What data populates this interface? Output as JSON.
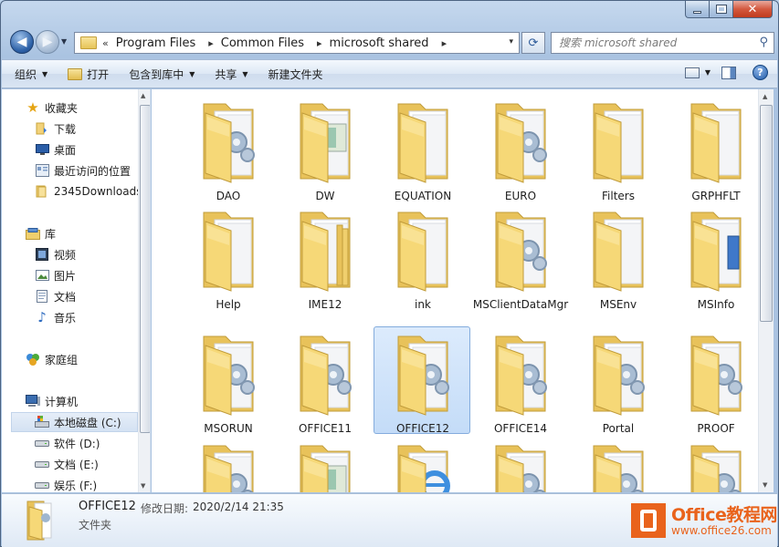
{
  "window": {
    "minimize_glyph": "",
    "close_glyph": "✕"
  },
  "address": {
    "overflow": "«",
    "crumbs": [
      "Program Files",
      "Common Files",
      "microsoft shared"
    ],
    "separator": "▸",
    "dropdown": "▾"
  },
  "search": {
    "placeholder": "搜索 microsoft shared"
  },
  "toolbar": {
    "organize": "组织",
    "open": "打开",
    "include_in_library": "包含到库中",
    "share": "共享",
    "new_folder": "新建文件夹",
    "help": "?"
  },
  "navpane": {
    "favorites": "收藏夹",
    "downloads": "下载",
    "desktop": "桌面",
    "recent": "最近访问的位置",
    "downloads2345": "2345Downloads",
    "libraries": "库",
    "videos": "视频",
    "pictures": "图片",
    "documents": "文档",
    "music": "音乐",
    "homegroup": "家庭组",
    "computer": "计算机",
    "drive_c": "本地磁盘 (C:)",
    "drive_d": "软件 (D:)",
    "drive_e": "文档 (E:)",
    "drive_f": "娱乐 (F:)"
  },
  "folders": [
    {
      "name": "DAO",
      "variant": "gear"
    },
    {
      "name": "DW",
      "variant": "doc"
    },
    {
      "name": "EQUATION",
      "variant": "plain"
    },
    {
      "name": "EURO",
      "variant": "gear"
    },
    {
      "name": "Filters",
      "variant": "plain"
    },
    {
      "name": "GRPHFLT",
      "variant": "plain"
    },
    {
      "name": "Help",
      "variant": "plain"
    },
    {
      "name": "IME12",
      "variant": "stack"
    },
    {
      "name": "ink",
      "variant": "plain"
    },
    {
      "name": "MSClientDataMgr",
      "variant": "gear"
    },
    {
      "name": "MSEnv",
      "variant": "plain"
    },
    {
      "name": "MSInfo",
      "variant": "blue"
    },
    {
      "name": "MSORUN",
      "variant": "gear"
    },
    {
      "name": "OFFICE11",
      "variant": "gear"
    },
    {
      "name": "OFFICE12",
      "variant": "gear"
    },
    {
      "name": "OFFICE14",
      "variant": "gear"
    },
    {
      "name": "Portal",
      "variant": "gear"
    },
    {
      "name": "PROOF",
      "variant": "gear"
    },
    {
      "name": "",
      "variant": "gear"
    },
    {
      "name": "",
      "variant": "doc"
    },
    {
      "name": "",
      "variant": "ie"
    },
    {
      "name": "",
      "variant": "gear"
    },
    {
      "name": "",
      "variant": "gear"
    },
    {
      "name": "",
      "variant": "gear"
    }
  ],
  "selected_folder": "OFFICE12",
  "details": {
    "name": "OFFICE12",
    "modified_label": "修改日期:",
    "modified_value": "2020/2/14 21:35",
    "type": "文件夹"
  },
  "watermark": {
    "title": "Office教程网",
    "url": "www.office26.com"
  },
  "colors": {
    "folder_front": "#f6d877",
    "folder_back": "#e8c25a",
    "selection": "#c4dcf8",
    "watermark": "#e9631c"
  }
}
